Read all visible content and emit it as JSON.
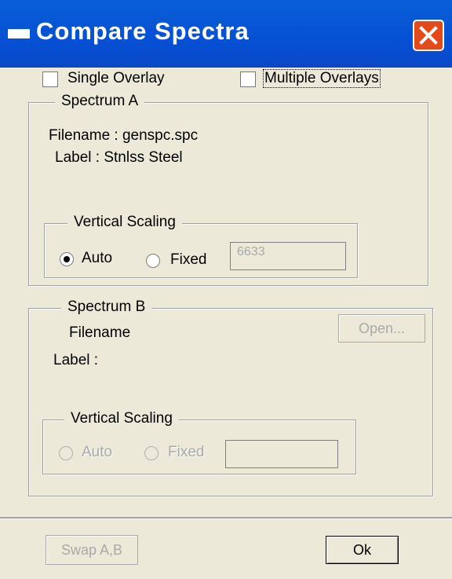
{
  "window": {
    "title": "Compare Spectra",
    "close_icon": "close-icon",
    "system_icon": "window-icon"
  },
  "overlay_options": {
    "single_label": "Single Overlay",
    "single_checked": false,
    "multiple_label": "Multiple Overlays",
    "multiple_checked": false
  },
  "spectrum_a": {
    "group_label": "Spectrum A",
    "filename_line": "Filename :  genspc.spc",
    "label_line": "Label : Stnlss Steel",
    "vertical_scaling": {
      "group_label": "Vertical Scaling",
      "auto_label": "Auto",
      "fixed_label": "Fixed",
      "selected": "Auto",
      "fixed_value": "6633"
    }
  },
  "spectrum_b": {
    "group_label": "Spectrum B",
    "filename_line": "Filename",
    "label_line": "Label :",
    "open_button": "Open...",
    "vertical_scaling": {
      "group_label": "Vertical Scaling",
      "auto_label": "Auto",
      "fixed_label": "Fixed",
      "selected": "",
      "fixed_value": ""
    }
  },
  "footer": {
    "swap_button": "Swap A,B",
    "ok_button": "Ok"
  }
}
